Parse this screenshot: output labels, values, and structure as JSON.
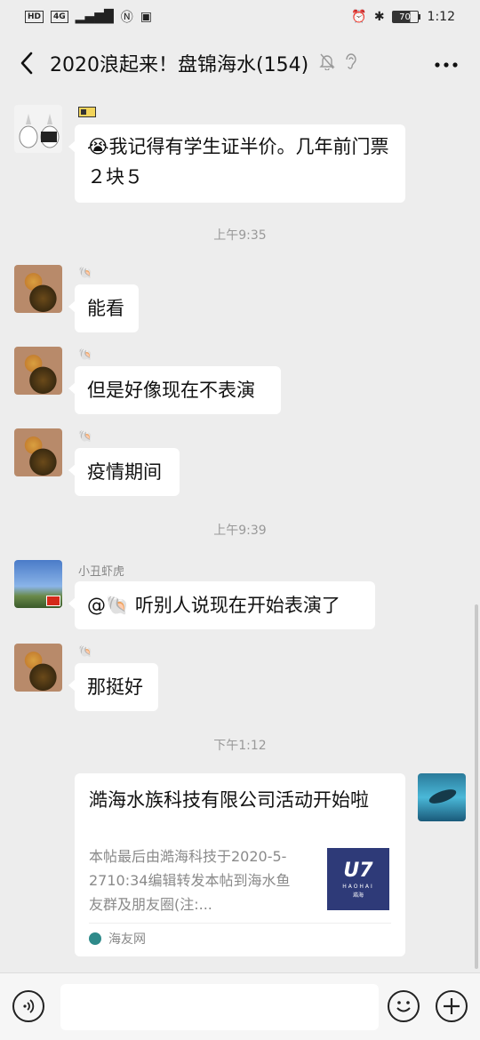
{
  "status_bar": {
    "network_tags": [
      "HD",
      "4G"
    ],
    "time": "1:12",
    "battery": "70"
  },
  "header": {
    "title": "2020浪起来！盘锦海水(154)",
    "icons": [
      "back-icon",
      "mute-bell-icon",
      "ear-icon",
      "more-icon"
    ]
  },
  "chat": {
    "messages": [
      {
        "type": "text",
        "sender": "",
        "text": "😭我记得有学生证半价。几年前门票２块５"
      },
      {
        "type": "time",
        "text": "上午9:35"
      },
      {
        "type": "text",
        "sender": "",
        "text": "能看"
      },
      {
        "type": "text",
        "sender": "",
        "text": "但是好像现在不表演"
      },
      {
        "type": "text",
        "sender": "",
        "text": "疫情期间"
      },
      {
        "type": "time",
        "text": "上午9:39"
      },
      {
        "type": "text",
        "sender": "小丑虾虎",
        "text": "@🐚  听别人说现在开始表演了"
      },
      {
        "type": "text",
        "sender": "",
        "text": "那挺好"
      },
      {
        "type": "time",
        "text": "下午1:12"
      },
      {
        "type": "link",
        "title": "澔海水族科技有限公司活动开始啦",
        "description": "本帖最后由澔海科技于2020-5-2710:34编辑转发本帖到海水鱼友群及朋友圈(注:...",
        "thumb": {
          "logo": "U7",
          "sub": "HAOHAI",
          "cn": "澔海"
        },
        "source": "海友网"
      }
    ]
  },
  "input_bar": {
    "placeholder": "",
    "icons": [
      "voice-icon",
      "emoji-icon",
      "plus-icon"
    ]
  }
}
